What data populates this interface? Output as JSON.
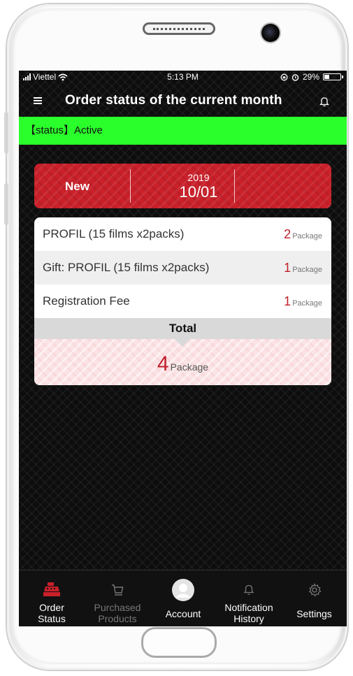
{
  "status_bar": {
    "carrier": "Viettel",
    "time": "5:13 PM",
    "battery": "29%"
  },
  "header": {
    "title": "Order status of the current month"
  },
  "status_line": {
    "text": "【status】Active"
  },
  "order": {
    "status": "New",
    "year": "2019",
    "date": "10/01"
  },
  "items": [
    {
      "name": "PROFIL (15 films x2packs)",
      "qty": "2",
      "unit": "Package"
    },
    {
      "name": "Gift: PROFIL (15 films x2packs)",
      "qty": "1",
      "unit": "Package"
    },
    {
      "name": "Registration Fee",
      "qty": "1",
      "unit": "Package"
    }
  ],
  "total": {
    "label": "Total",
    "qty": "4",
    "unit": "Package"
  },
  "tabs": [
    {
      "line1": "Order",
      "line2": "Status",
      "icon": "cash-register-icon",
      "active": true
    },
    {
      "line1": "Purchased",
      "line2": "Products",
      "icon": "cart-icon",
      "active": false
    },
    {
      "line1": "Account",
      "line2": "",
      "icon": "avatar-icon",
      "active": false
    },
    {
      "line1": "Notification",
      "line2": "History",
      "icon": "bell-icon",
      "active": false
    },
    {
      "line1": "Settings",
      "line2": "",
      "icon": "gear-icon",
      "active": false
    }
  ],
  "colors": {
    "accent_red": "#c9202a",
    "status_green": "#2bff2b",
    "background": "#0d0d0d"
  }
}
